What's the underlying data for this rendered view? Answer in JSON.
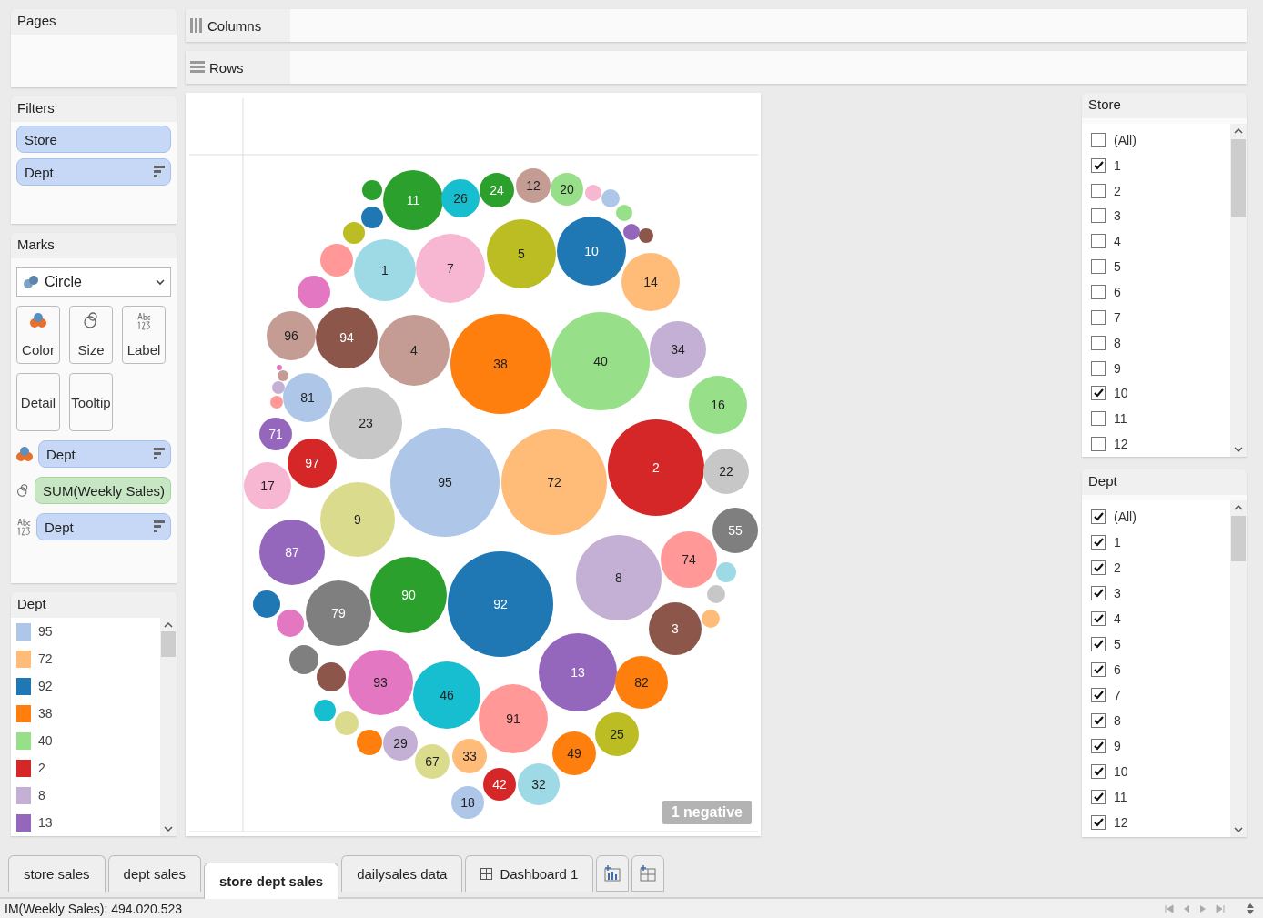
{
  "pages": {
    "title": "Pages"
  },
  "shelves": [
    {
      "label": "Columns",
      "kind": "columns"
    },
    {
      "label": "Rows",
      "kind": "rows"
    }
  ],
  "filters": {
    "title": "Filters",
    "pills": [
      {
        "label": "Store",
        "sorted": false
      },
      {
        "label": "Dept",
        "sorted": true
      }
    ]
  },
  "marks": {
    "title": "Marks",
    "mark_type": "Circle",
    "buttons": [
      {
        "label": "Color",
        "kind": "color"
      },
      {
        "label": "Size",
        "kind": "size"
      },
      {
        "label": "Label",
        "kind": "label"
      },
      {
        "label": "Detail",
        "kind": "detail"
      },
      {
        "label": "Tooltip",
        "kind": "tooltip"
      }
    ],
    "pills": [
      {
        "label": "Dept",
        "kind": "color",
        "measure": false,
        "sorted": true
      },
      {
        "label": "SUM(Weekly Sales)",
        "kind": "size",
        "measure": true,
        "sorted": false
      },
      {
        "label": "Dept",
        "kind": "label",
        "measure": false,
        "sorted": true
      }
    ]
  },
  "legend": {
    "title": "Dept",
    "items": [
      {
        "label": "95",
        "color": "#aec7e8"
      },
      {
        "label": "72",
        "color": "#ffbb78"
      },
      {
        "label": "92",
        "color": "#1f77b4"
      },
      {
        "label": "38",
        "color": "#ff7f0e"
      },
      {
        "label": "40",
        "color": "#98df8a"
      },
      {
        "label": "2",
        "color": "#d62728"
      },
      {
        "label": "8",
        "color": "#c5b0d5"
      },
      {
        "label": "13",
        "color": "#9467bd"
      }
    ]
  },
  "chart": {
    "badge": "1 negative",
    "bubbles": [
      {
        "label": "11",
        "color": "#2ca02c"
      },
      {
        "label": "26",
        "color": "#17becf"
      },
      {
        "label": "24",
        "color": "#2ca02c"
      },
      {
        "label": "12",
        "color": "#c49c94"
      },
      {
        "label": "20",
        "color": "#98df8a"
      },
      {
        "color": "#f7b6d2"
      },
      {
        "color": "#aec7e8"
      },
      {
        "color": "#98df8a"
      },
      {
        "color": "#9467bd"
      },
      {
        "color": "#8c564b"
      },
      {
        "color": "#2ca02c"
      },
      {
        "color": "#1f77b4"
      },
      {
        "color": "#bcbd22"
      },
      {
        "color": "#ff9896"
      },
      {
        "color": "#e377c2"
      },
      {
        "label": "1",
        "color": "#9edae5"
      },
      {
        "label": "7",
        "color": "#f7b6d2"
      },
      {
        "label": "5",
        "color": "#bcbd22"
      },
      {
        "label": "10",
        "color": "#1f77b4"
      },
      {
        "label": "14",
        "color": "#ffbb78"
      },
      {
        "label": "96",
        "color": "#c49c94"
      },
      {
        "label": "94",
        "color": "#8c564b"
      },
      {
        "label": "4",
        "color": "#c49c94"
      },
      {
        "label": "38",
        "color": "#ff7f0e"
      },
      {
        "label": "40",
        "color": "#98df8a"
      },
      {
        "label": "34",
        "color": "#c5b0d5"
      },
      {
        "label": "16",
        "color": "#98df8a"
      },
      {
        "color": "#e377c2"
      },
      {
        "color": "#c49c94"
      },
      {
        "color": "#c5b0d5"
      },
      {
        "color": "#ff9896"
      },
      {
        "label": "81",
        "color": "#aec7e8"
      },
      {
        "label": "23",
        "color": "#c7c7c7"
      },
      {
        "label": "71",
        "color": "#9467bd"
      },
      {
        "label": "97",
        "color": "#d62728"
      },
      {
        "label": "17",
        "color": "#f7b6d2"
      },
      {
        "label": "95",
        "color": "#aec7e8"
      },
      {
        "label": "72",
        "color": "#ffbb78"
      },
      {
        "label": "2",
        "color": "#d62728"
      },
      {
        "label": "22",
        "color": "#c7c7c7"
      },
      {
        "label": "55",
        "color": "#7f7f7f"
      },
      {
        "label": "9",
        "color": "#dbdb8d"
      },
      {
        "label": "87",
        "color": "#9467bd"
      },
      {
        "label": "74",
        "color": "#ff9896"
      },
      {
        "color": "#9edae5"
      },
      {
        "color": "#c7c7c7"
      },
      {
        "color": "#ffbb78"
      },
      {
        "label": "8",
        "color": "#c5b0d5"
      },
      {
        "label": "90",
        "color": "#2ca02c"
      },
      {
        "label": "92",
        "color": "#1f77b4"
      },
      {
        "label": "79",
        "color": "#7f7f7f"
      },
      {
        "color": "#1f77b4"
      },
      {
        "color": "#e377c2"
      },
      {
        "color": "#7f7f7f"
      },
      {
        "color": "#8c564b"
      },
      {
        "label": "3",
        "color": "#8c564b"
      },
      {
        "label": "13",
        "color": "#9467bd"
      },
      {
        "label": "82",
        "color": "#ff7f0e"
      },
      {
        "label": "93",
        "color": "#e377c2"
      },
      {
        "label": "46",
        "color": "#17becf"
      },
      {
        "label": "91",
        "color": "#ff9896"
      },
      {
        "color": "#17becf"
      },
      {
        "color": "#dbdb8d"
      },
      {
        "color": "#ff7f0e"
      },
      {
        "label": "29",
        "color": "#c5b0d5"
      },
      {
        "label": "67",
        "color": "#dbdb8d"
      },
      {
        "label": "33",
        "color": "#ffbb78"
      },
      {
        "label": "49",
        "color": "#ff7f0e"
      },
      {
        "label": "25",
        "color": "#bcbd22"
      },
      {
        "label": "42",
        "color": "#d62728"
      },
      {
        "label": "32",
        "color": "#9edae5"
      },
      {
        "label": "18",
        "color": "#aec7e8"
      }
    ]
  },
  "store_filter": {
    "title": "Store",
    "items": [
      {
        "label": "(All)",
        "checked": false
      },
      {
        "label": "1",
        "checked": true
      },
      {
        "label": "2",
        "checked": false
      },
      {
        "label": "3",
        "checked": false
      },
      {
        "label": "4",
        "checked": false
      },
      {
        "label": "5",
        "checked": false
      },
      {
        "label": "6",
        "checked": false
      },
      {
        "label": "7",
        "checked": false
      },
      {
        "label": "8",
        "checked": false
      },
      {
        "label": "9",
        "checked": false
      },
      {
        "label": "10",
        "checked": true
      },
      {
        "label": "11",
        "checked": false
      },
      {
        "label": "12",
        "checked": false
      }
    ]
  },
  "dept_filter": {
    "title": "Dept",
    "items": [
      {
        "label": "(All)",
        "checked": true
      },
      {
        "label": "1",
        "checked": true
      },
      {
        "label": "2",
        "checked": true
      },
      {
        "label": "3",
        "checked": true
      },
      {
        "label": "4",
        "checked": true
      },
      {
        "label": "5",
        "checked": true
      },
      {
        "label": "6",
        "checked": true
      },
      {
        "label": "7",
        "checked": true
      },
      {
        "label": "8",
        "checked": true
      },
      {
        "label": "9",
        "checked": true
      },
      {
        "label": "10",
        "checked": true
      },
      {
        "label": "11",
        "checked": true
      },
      {
        "label": "12",
        "checked": true
      }
    ]
  },
  "sheet_tabs": [
    {
      "label": "store sales",
      "kind": "sheet",
      "selected": false
    },
    {
      "label": "dept sales",
      "kind": "sheet",
      "selected": false
    },
    {
      "label": "store dept sales",
      "kind": "sheet",
      "selected": true
    },
    {
      "label": "dailysales data",
      "kind": "sheet",
      "selected": false
    },
    {
      "label": "Dashboard 1",
      "kind": "dashboard",
      "selected": false
    }
  ],
  "status_bar": {
    "text": "IM(Weekly Sales): 494.020.523"
  }
}
